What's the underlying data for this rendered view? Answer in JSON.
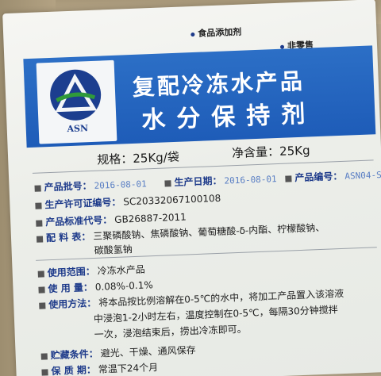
{
  "top": {
    "label1": "食品添加剂",
    "label2": "非零售"
  },
  "logo": {
    "text": "ASN"
  },
  "banner": {
    "title_line1": "复配冷冻水产品",
    "title_line2": "水分保持剂"
  },
  "spec": {
    "spec_label": "规格：",
    "spec_value": "25Kg/袋",
    "net_label": "净含量：",
    "net_value": "25Kg"
  },
  "fields": {
    "batch_label": "产品批号：",
    "batch_value": "2016-08-01",
    "prod_date_label": "生产日期：",
    "prod_date_value": "2016-08-01",
    "code_label": "产品编号：",
    "code_value": "ASN04-S",
    "license_label": "生产许可证编号：",
    "license_value": "SC20332067100108",
    "standard_label": "产品标准代号：",
    "standard_value": "GB26887-2011",
    "ingredients_label": "配 料 表：",
    "ingredients_line1": "三聚磷酸钠、焦磷酸钠、葡萄糖酸-δ-内酯、柠檬酸钠、",
    "ingredients_line2": "碳酸氢钠",
    "scope_label": "使用范围：",
    "scope_value": "冷冻水产品",
    "dosage_label": "使 用 量：",
    "dosage_value": "0.08%-0.1%",
    "method_label": "使用方法：",
    "method_line1": "将本品按比例溶解在0-5℃的水中，将加工产品置入该溶液",
    "method_line2": "中浸泡1-2小时左右，温度控制在0-5℃，每隔30分钟搅拌",
    "method_line3": "一次，浸泡结束后，捞出冷冻即可。",
    "storage_label": "贮藏条件：",
    "storage_value": "避光、干燥、通风保存",
    "shelf_label": "保 质 期：",
    "shelf_value": "常温下24个月"
  }
}
